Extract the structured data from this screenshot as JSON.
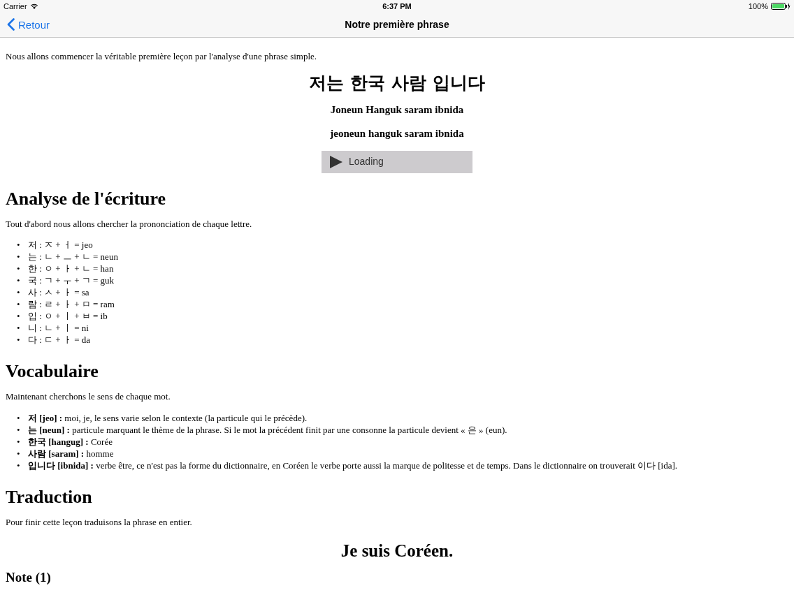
{
  "status_bar": {
    "carrier": "Carrier",
    "time": "6:37 PM",
    "battery": "100%"
  },
  "nav_bar": {
    "back": "Retour",
    "title": "Notre première phrase"
  },
  "intro": "Nous allons commencer la véritable première leçon par l'analyse d'une phrase simple.",
  "phrase": "저는 한국 사람 입니다",
  "romanizations": [
    "Joneun Hanguk saram ibnida",
    "jeoneun hanguk saram ibnida"
  ],
  "audio_player": {
    "status": "Loading"
  },
  "bullet": "•",
  "sections": [
    {
      "heading": "Analyse de l'écriture",
      "text": "Tout d'abord nous allons chercher la prononciation de chaque lettre.",
      "items": [
        "저 : ㅈ + ㅓ = jeo",
        "는 : ㄴ + ㅡ + ㄴ = neun",
        "한 : ㅇ + ㅏ + ㄴ = han",
        "국 : ㄱ + ㅜ + ㄱ = guk",
        "사 : ㅅ + ㅏ = sa",
        "람 : ㄹ + ㅏ + ㅁ = ram",
        "입 : ㅇ + ㅣ + ㅂ = ib",
        "니 : ㄴ + ㅣ = ni",
        "다 : ㄷ + ㅏ = da"
      ]
    },
    {
      "heading": "Vocabulaire",
      "text": "Maintenant cherchons le sens de chaque mot.",
      "items": [
        "**저 [jeo] :** moi, je, le sens varie selon le contexte (la particule qui le précède).",
        "**는 [neun] :** particule marquant le thème de la phrase. Si le mot la précédent finit par une consonne la particule devient « 은 » (eun).",
        "**한국 [hangug] :** Corée",
        "**사람 [saram] :** homme",
        "**입니다 [ibnida] :** verbe être, ce n'est pas la forme du dictionnaire, en Coréen le verbe porte aussi la marque de politesse et de temps. Dans le dictionnaire on trouverait 이다 [ida]."
      ]
    },
    {
      "heading": "Traduction",
      "text": "Pour finir cette leçon traduisons la phrase en entier.",
      "translation": "Je suis Coréen."
    }
  ],
  "note_heading": "Note (1)"
}
